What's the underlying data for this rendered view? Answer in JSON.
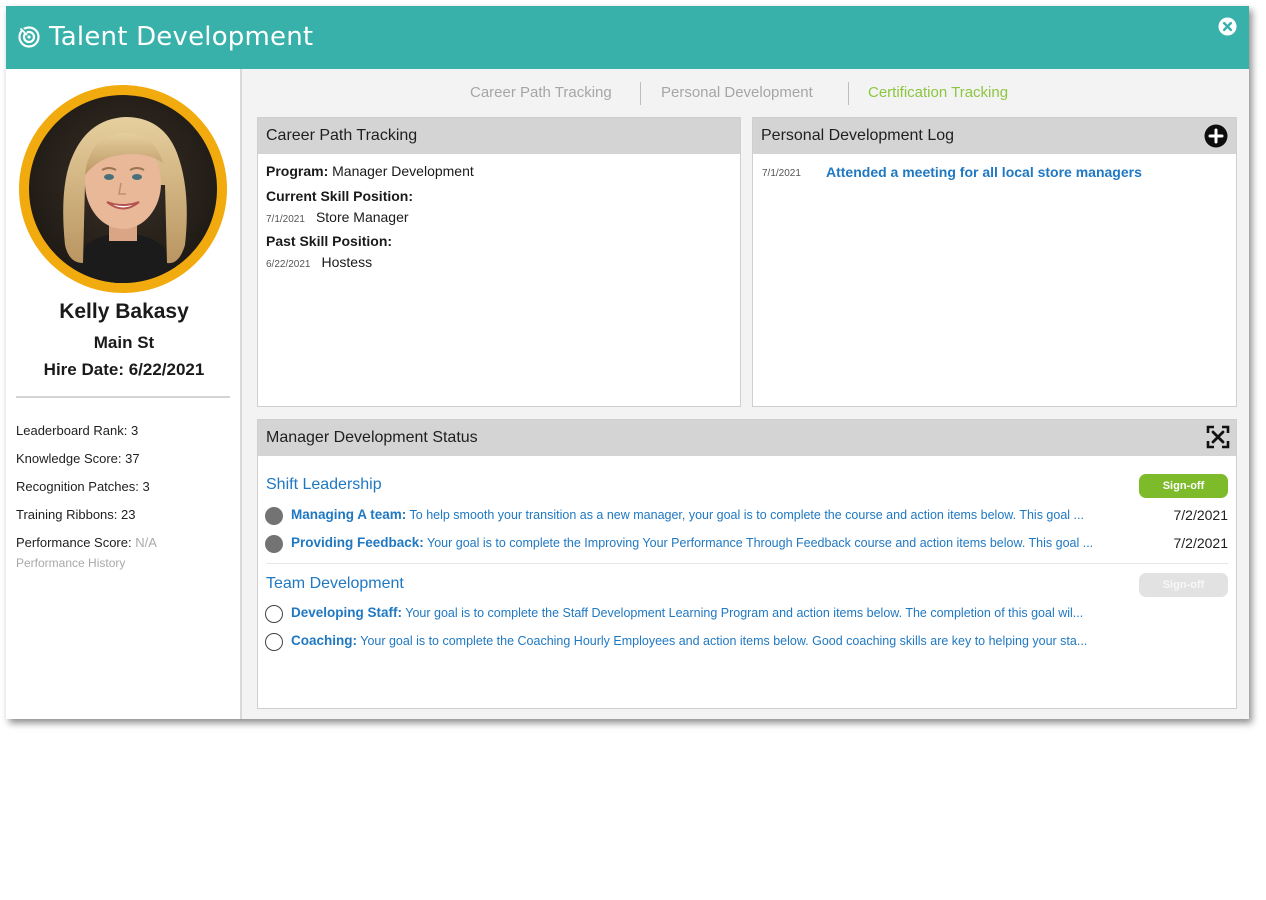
{
  "window": {
    "title": "Talent Development"
  },
  "profile": {
    "name": "Kelly Bakasy",
    "store": "Main St",
    "hire_date": "Hire Date: 6/22/2021",
    "stats": [
      {
        "label": "Leaderboard Rank:",
        "value": "3"
      },
      {
        "label": "Knowledge Score:",
        "value": "37"
      },
      {
        "label": "Recognition Patches:",
        "value": "3"
      },
      {
        "label": "Training Ribbons:",
        "value": "23"
      },
      {
        "label": "Performance Score:",
        "value": "N/A"
      }
    ],
    "history_link": "Performance History"
  },
  "tabs": [
    {
      "label": "Career Path Tracking",
      "active": false
    },
    {
      "label": "Personal Development",
      "active": false
    },
    {
      "label": "Certification Tracking",
      "active": true
    }
  ],
  "career_path": {
    "header": "Career Path Tracking",
    "program_label": "Program:",
    "program_value": "Manager Development",
    "current_label": "Current Skill Position:",
    "current_date": "7/1/2021",
    "current_position": "Store Manager",
    "past_label": "Past Skill Position:",
    "past_date": "6/22/2021",
    "past_position": "Hostess"
  },
  "dev_log": {
    "header": "Personal Development Log",
    "entries": [
      {
        "date": "7/1/2021",
        "text": "Attended a meeting for all local store managers"
      }
    ]
  },
  "status": {
    "header": "Manager Development Status",
    "sections": [
      {
        "title": "Shift Leadership",
        "signoff_label": "Sign-off",
        "signoff_enabled": true,
        "goals": [
          {
            "name": "Managing A team:",
            "desc": "To help smooth your transition as a new manager, your goal is to complete the course and action items below. This goal ...",
            "date": "7/2/2021",
            "complete": true
          },
          {
            "name": "Providing Feedback:",
            "desc": "Your goal is to complete the Improving Your Performance Through Feedback course and action items below. This goal ...",
            "date": "7/2/2021",
            "complete": true
          }
        ]
      },
      {
        "title": "Team Development",
        "signoff_label": "Sign-off",
        "signoff_enabled": false,
        "goals": [
          {
            "name": "Developing Staff:",
            "desc": "Your goal is to complete the Staff Development Learning Program and action items below. The completion of this goal wil...",
            "date": "",
            "complete": false
          },
          {
            "name": "Coaching:",
            "desc": "Your goal is to complete the Coaching Hourly Employees and action items below. Good coaching skills are key to helping your sta...",
            "date": "",
            "complete": false
          }
        ]
      }
    ]
  },
  "colors": {
    "titlebar": "#37b1aa",
    "avatar_ring": "#f2ab0f",
    "active_tab": "#8cc63f",
    "link": "#1f78c2",
    "signoff": "#7dbb2a"
  },
  "icons": {
    "title": "target-icon",
    "close": "close-circle-icon",
    "add": "plus-circle-icon",
    "expand": "expand-icon"
  }
}
